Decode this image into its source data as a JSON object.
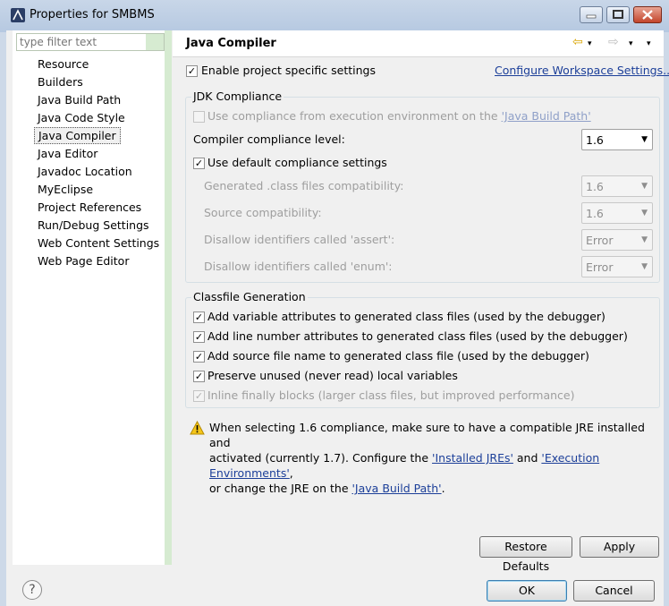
{
  "window": {
    "title": "Properties for SMBMS",
    "controls": {
      "minimize": "—",
      "maximize": "□",
      "close": "✕"
    }
  },
  "filter": {
    "placeholder": "type filter text"
  },
  "tree": {
    "items": [
      "Resource",
      "Builders",
      "Java Build Path",
      "Java Code Style",
      "Java Compiler",
      "Java Editor",
      "Javadoc Location",
      "MyEclipse",
      "Project References",
      "Run/Debug Settings",
      "Web Content Settings",
      "Web Page Editor"
    ],
    "selected": "Java Compiler"
  },
  "page": {
    "title": "Java Compiler",
    "nav": {
      "back": "⇦",
      "forward": "⇨",
      "menu": "▾"
    },
    "enable_specific": {
      "label": "Enable project specific settings",
      "checked": true
    },
    "configure_link": "Configure Workspace Settings...",
    "jdk": {
      "title": "JDK Compliance",
      "use_env": {
        "label": "Use compliance from execution environment on the ",
        "link": "'Java Build Path'",
        "checked": false,
        "disabled": true
      },
      "compliance_label": "Compiler compliance level:",
      "compliance_value": "1.6",
      "use_default": {
        "label": "Use default compliance settings",
        "checked": true
      },
      "rows": [
        {
          "label": "Generated .class files compatibility:",
          "value": "1.6"
        },
        {
          "label": "Source compatibility:",
          "value": "1.6"
        },
        {
          "label": "Disallow identifiers called 'assert':",
          "value": "Error"
        },
        {
          "label": "Disallow identifiers called 'enum':",
          "value": "Error"
        }
      ]
    },
    "classfile": {
      "title": "Classfile Generation",
      "options": [
        {
          "label": "Add variable attributes to generated class files (used by the debugger)",
          "checked": true,
          "disabled": false
        },
        {
          "label": "Add line number attributes to generated class files (used by the debugger)",
          "checked": true,
          "disabled": false
        },
        {
          "label": "Add source file name to generated class file (used by the debugger)",
          "checked": true,
          "disabled": false
        },
        {
          "label": "Preserve unused (never read) local variables",
          "checked": true,
          "disabled": false
        },
        {
          "label": "Inline finally blocks (larger class files, but improved performance)",
          "checked": true,
          "disabled": true
        }
      ]
    },
    "warning": {
      "icon": "warning-icon",
      "line1": "When selecting 1.6 compliance, make sure to have a compatible JRE installed and",
      "line2_pre": "activated (currently 1.7). Configure the ",
      "installed_jres": "'Installed JREs'",
      "and": " and ",
      "exec_envs": "'Execution Environments'",
      "comma": ",",
      "line3_pre": "or change the JRE on the ",
      "build_path": "'Java Build Path'",
      "period": "."
    },
    "restore_defaults": "Restore Defaults",
    "apply": "Apply"
  },
  "footer": {
    "help": "?",
    "ok": "OK",
    "cancel": "Cancel"
  },
  "colors": {
    "accent": "#1c3f99",
    "tree_green": "#d6ebd1",
    "warning": "#e8b400"
  }
}
